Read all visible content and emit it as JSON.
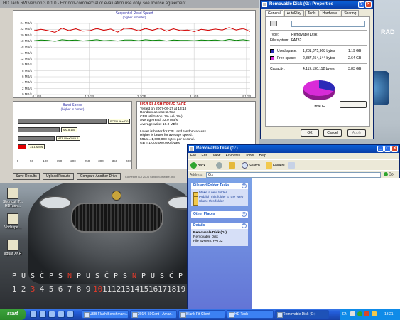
{
  "colors": {
    "seq_red": "#d40000",
    "seq_green": "#008000",
    "sky": "#c9d3dc",
    "xp_blue": "#245edb"
  },
  "hdtach": {
    "title": "HD Tach RW version 3.0.1.0  - For non-commercial or evaluation use only, see license agreement.",
    "seq_title": "Sequential Read Speed",
    "seq_subtitle": "(higher is better)",
    "burst_title": "Burst Speed",
    "burst_subtitle": "(higher is better)",
    "info": {
      "heading": "USB FLASH DRIVE 34CE",
      "tested": "Tested on 2007-06-27 at 13:18",
      "random_access": "Random access: 2.7ms",
      "cpu": "CPU utilization: 7% (+/- 2%)",
      "avg_read": "Average read: 22.0 MB/s",
      "avg_write": "Average write: 10.0 MB/s",
      "note1": "Lower is better for CPU and random access.",
      "note2": "Higher is better for average speed.",
      "note3": "MB/s = 1,000,000 bytes per second.",
      "note4": "GB = 1,000,000,000 bytes."
    },
    "buttons": {
      "save": "Save Results",
      "upload": "Upload Results",
      "compare": "Compare Another Drive"
    },
    "copyright": "Copyright (C) 2004 Simpli Software, Inc."
  },
  "chart_data": [
    {
      "type": "line",
      "title": "Sequential Read Speed",
      "subtitle": "(higher is better)",
      "xticks": [
        "0.1GB",
        "1.1GB",
        "2.1GB",
        "3.1GB",
        "4.1GB"
      ],
      "yticks": [
        "24 MB/s",
        "22 MB/s",
        "20 MB/s",
        "18 MB/s",
        "16 MB/s",
        "14 MB/s",
        "12 MB/s",
        "10 MB/s",
        "8 MB/s",
        "6 MB/s",
        "4 MB/s",
        "2 MB/s",
        "0 MB/s"
      ],
      "ylim": [
        0,
        24
      ],
      "series": [
        {
          "values": [
            21.6,
            22.0,
            21.6,
            21.0,
            22.4,
            21.6,
            22.2,
            21.4,
            21.6,
            22.3,
            21.7,
            22.1,
            21.1,
            22.4,
            22.2,
            21.5,
            22.3,
            21.7,
            22.4,
            21.4,
            22.2,
            21.6,
            21.8,
            21.3,
            22.0,
            21.7,
            22.1,
            21.8,
            22.6,
            21.8,
            22.3,
            21.3
          ]
        },
        {
          "values": [
            18.2,
            18.4,
            18.3,
            18.0,
            18.5,
            18.3,
            18.4,
            18.1,
            18.3,
            18.5,
            18.2,
            18.3,
            18.1,
            18.4,
            18.4,
            18.2,
            18.5,
            18.3,
            18.4,
            18.1,
            18.4,
            18.3,
            18.3,
            18.2,
            18.4,
            18.3,
            18.4,
            18.2,
            18.6,
            18.3,
            18.5,
            18.2
          ]
        }
      ]
    },
    {
      "type": "bar",
      "title": "Burst Speed",
      "subtitle": "(higher is better)",
      "categories": [
        "SCSI Ultra320",
        "SATA 150",
        "ATA UltraDMA 6",
        "31.1 MB/s"
      ],
      "values": [
        320,
        150,
        133,
        31.1
      ],
      "xticks": [
        "0",
        "50",
        "100",
        "150",
        "200",
        "250",
        "300",
        "350",
        "400"
      ],
      "xlim": [
        0,
        400
      ]
    }
  ],
  "properties": {
    "title": "Removable Disk (G:) Properties",
    "tabs": [
      "General",
      "AutoPlay",
      "Tools",
      "Hardware",
      "Sharing"
    ],
    "type_label": "Type:",
    "type_value": "Removable Disk",
    "fs_label": "File system:",
    "fs_value": "FAT32",
    "used_label": "Used space:",
    "used_bytes": "1,281,875,968 bytes",
    "used_size": "1.19 GB",
    "free_label": "Free space:",
    "free_bytes": "2,837,254,144 bytes",
    "free_size": "2.64 GB",
    "cap_label": "Capacity:",
    "cap_bytes": "4,119,130,112 bytes",
    "cap_size": "3.83 GB",
    "drive_label": "Drive G",
    "used_fraction": 0.311,
    "used_color": "#2a2ab8",
    "free_color": "#d82bd8",
    "buttons": {
      "ok": "OK",
      "cancel": "Cancel",
      "apply": "Apply"
    }
  },
  "explorer": {
    "title": "Removable Disk (G:)",
    "menu": [
      "File",
      "Edit",
      "View",
      "Favorites",
      "Tools",
      "Help"
    ],
    "toolbar": {
      "back": "Back",
      "search": "Search",
      "folders": "Folders"
    },
    "address_label": "Address",
    "address_value": "G:\\",
    "go": "Go",
    "tasks_header": "File and Folder Tasks",
    "tasks": [
      "Make a new folder",
      "Publish this folder to the Web",
      "Share this folder"
    ],
    "other_header": "Other Places",
    "details_header": "Details",
    "details_name": "Removable Disk (G:)",
    "details_type": "Removable Disk",
    "details_fs": "File System: FAT32"
  },
  "desktop": {
    "icons": [
      "Shortcut_T... HDTach...",
      "Vodaspe...",
      "aguar XKR"
    ],
    "right_label": "RAD"
  },
  "calendar": {
    "days": [
      "P",
      "U",
      "S",
      "Č",
      "P",
      "S",
      "N",
      "P",
      "U",
      "S",
      "Č",
      "P",
      "S",
      "N",
      "P",
      "U",
      "S",
      "Č",
      "P"
    ],
    "nums": [
      "1",
      "2",
      "3",
      "4",
      "5",
      "6",
      "7",
      "8",
      "9",
      "10",
      "11",
      "12",
      "13",
      "14",
      "15",
      "16",
      "17",
      "18",
      "19"
    ],
    "red_index": [
      2,
      9
    ]
  },
  "taskbar": {
    "start": "start",
    "tasks": [
      "USB Flash Benchmark...",
      "2014. 50Cent - Amar...",
      "Blank Fit Client",
      "HD Tach",
      "Removable Disk (G:)"
    ],
    "tray_lang": "EN",
    "clock": "13:21"
  }
}
